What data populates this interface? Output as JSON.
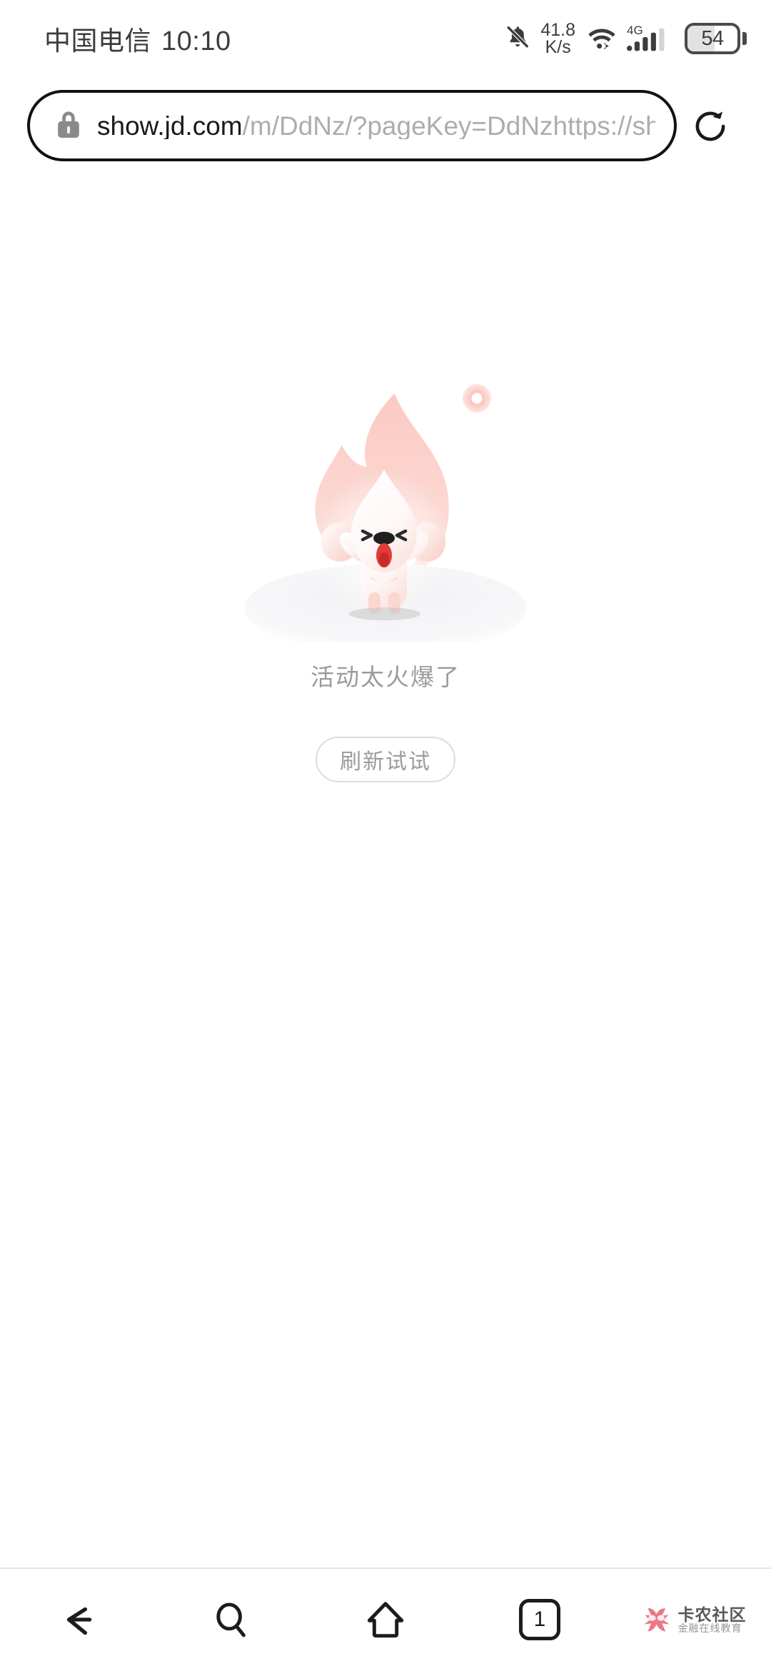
{
  "status_bar": {
    "carrier": "中国电信",
    "clock": "10:10",
    "network_speed_value": "41.8",
    "network_speed_unit": "K/s",
    "battery_level": "54",
    "battery_percent": 54,
    "mobile_network": "4G",
    "icons": {
      "notifications": "bell-muted-icon",
      "wifi": "wifi-icon",
      "signal": "signal-bars-icon",
      "battery": "battery-icon"
    }
  },
  "browser": {
    "url_host": "show.jd.com",
    "url_path": "/m/DdNz/?pageKey=DdNzhttps://show",
    "url_full": "show.jd.com/m/DdNz/?pageKey=DdNzhttps://show",
    "lock_icon": "lock-icon",
    "reload_icon": "reload-icon",
    "reload_label": "刷新"
  },
  "page": {
    "error_message": "活动太火爆了",
    "refresh_button_label": "刷新试试",
    "illustration_name": "jd-joy-dog-flame-illustration"
  },
  "bottom_nav": {
    "back_label": "返回",
    "search_label": "搜索",
    "home_label": "主页",
    "tab_count": "1",
    "items": [
      {
        "name": "back-button",
        "icon": "arrow-left-icon"
      },
      {
        "name": "search-button",
        "icon": "search-icon"
      },
      {
        "name": "home-button",
        "icon": "home-icon"
      },
      {
        "name": "tab-switcher-button",
        "icon": "tab-count-icon"
      },
      {
        "name": "watermark",
        "icon": "kanong-logo-icon"
      }
    ]
  },
  "watermark": {
    "title": "卡农社区",
    "subtitle": "金融在线教育"
  },
  "colors": {
    "background": "#ffffff",
    "flame_pink": "#fbd7d1",
    "flame_pink_deep": "#f8c4bc",
    "accent_red": "#e4393c",
    "text_gray": "#9b9b9b",
    "text_dark": "#1a1a1a",
    "url_path_gray": "#adadad",
    "border_gray": "#dcdcdc",
    "nav_divider": "#e3e3e3"
  }
}
